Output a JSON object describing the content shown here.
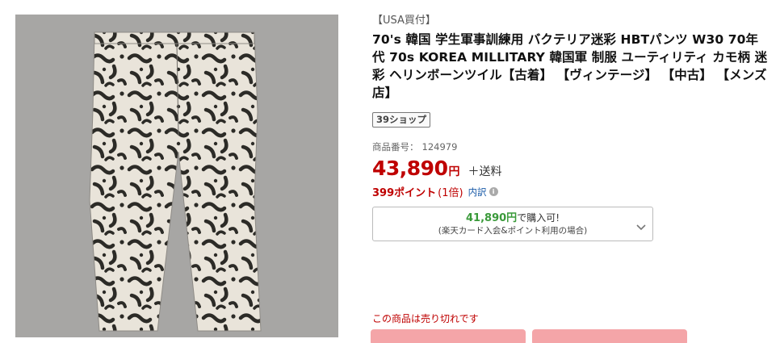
{
  "product": {
    "image_alt": "camouflage HBT pants",
    "tag": "【USA買付】",
    "title": "70's 韓国 学生軍事訓練用 バクテリア迷彩 HBTパンツ W30 70年代 70s KOREA MILLITARY 韓国軍 制服 ユーティリティ カモ柄 迷彩 ヘリンボーンツイル【古着】 【ヴィンテージ】 【中古】 【メンズ店】",
    "shop_badge": "39ショップ",
    "item_no_label": "商品番号：",
    "item_no": "124979",
    "price": "43,890",
    "currency": "円",
    "shipping": "＋送料",
    "points": "399ポイント",
    "points_rate": "(1倍)",
    "breakdown_link": "内訳",
    "card_offer": {
      "amount": "41,890",
      "currency": "円",
      "suffix": "で購入可!",
      "note": "(楽天カード入会&ポイント利用の場合)"
    },
    "soldout_text": "この商品は売り切れです"
  },
  "colors": {
    "price_red": "#bf0000",
    "green": "#3a9a3a",
    "link_blue": "#1a5ba8",
    "disabled_button": "#f4a5a8"
  },
  "icons": {
    "info": "info-icon",
    "chevron": "chevron-down-icon"
  }
}
